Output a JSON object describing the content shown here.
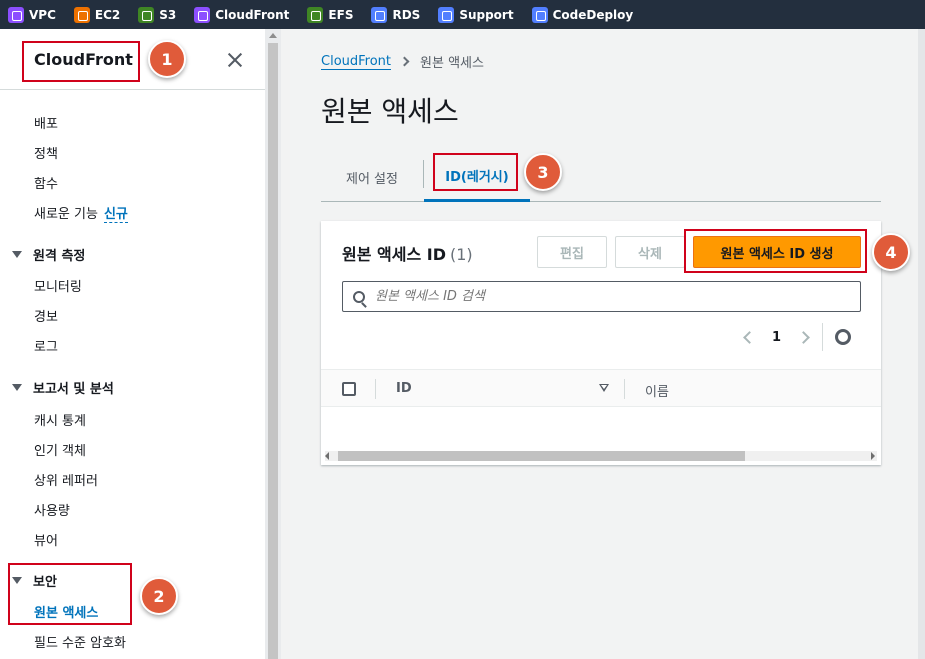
{
  "topbar": {
    "services": [
      {
        "label": "VPC",
        "icon": "vpc-icon",
        "color": "#8c4fff"
      },
      {
        "label": "EC2",
        "icon": "ec2-icon",
        "color": "#ed7100"
      },
      {
        "label": "S3",
        "icon": "s3-icon",
        "color": "#3f8624"
      },
      {
        "label": "CloudFront",
        "icon": "cloudfront-icon",
        "color": "#8c4fff"
      },
      {
        "label": "EFS",
        "icon": "efs-icon",
        "color": "#3f8624"
      },
      {
        "label": "RDS",
        "icon": "rds-icon",
        "color": "#527fff"
      },
      {
        "label": "Support",
        "icon": "support-icon",
        "color": "#527fff"
      },
      {
        "label": "CodeDeploy",
        "icon": "codedeploy-icon",
        "color": "#527fff"
      }
    ]
  },
  "sidebar": {
    "title": "CloudFront",
    "items": {
      "distributions": "배포",
      "policies": "정책",
      "functions": "함수",
      "whats_new": "새로운 기능",
      "new_badge": "신규"
    },
    "telemetry": {
      "title": "원격 측정",
      "items": [
        "모니터링",
        "경보",
        "로그"
      ]
    },
    "reports": {
      "title": "보고서 및 분석",
      "items": [
        "캐시 통계",
        "인기 객체",
        "상위 레퍼러",
        "사용량",
        "뷰어"
      ]
    },
    "security": {
      "title": "보안",
      "items": [
        "원본 액세스",
        "필드 수준 암호화"
      ]
    }
  },
  "breadcrumb": {
    "root": "CloudFront",
    "current": "원본 액세스"
  },
  "page_title": "원본 액세스",
  "tabs": [
    "제어 설정",
    "ID(레거시)"
  ],
  "panel": {
    "title": "원본 액세스 ID",
    "count": "(1)",
    "edit_button": "편집",
    "delete_button": "삭제",
    "create_button": "원본 액세스 ID 생성",
    "search_placeholder": "원본 액세스 ID 검색",
    "page_number": "1",
    "columns": [
      "ID",
      "이름"
    ]
  },
  "annotations": [
    "1",
    "2",
    "3",
    "4"
  ],
  "colors": {
    "accent": "#0073bb",
    "primary_button": "#ff9900",
    "highlight": "#d0021b",
    "badge": "#e05b3a"
  }
}
